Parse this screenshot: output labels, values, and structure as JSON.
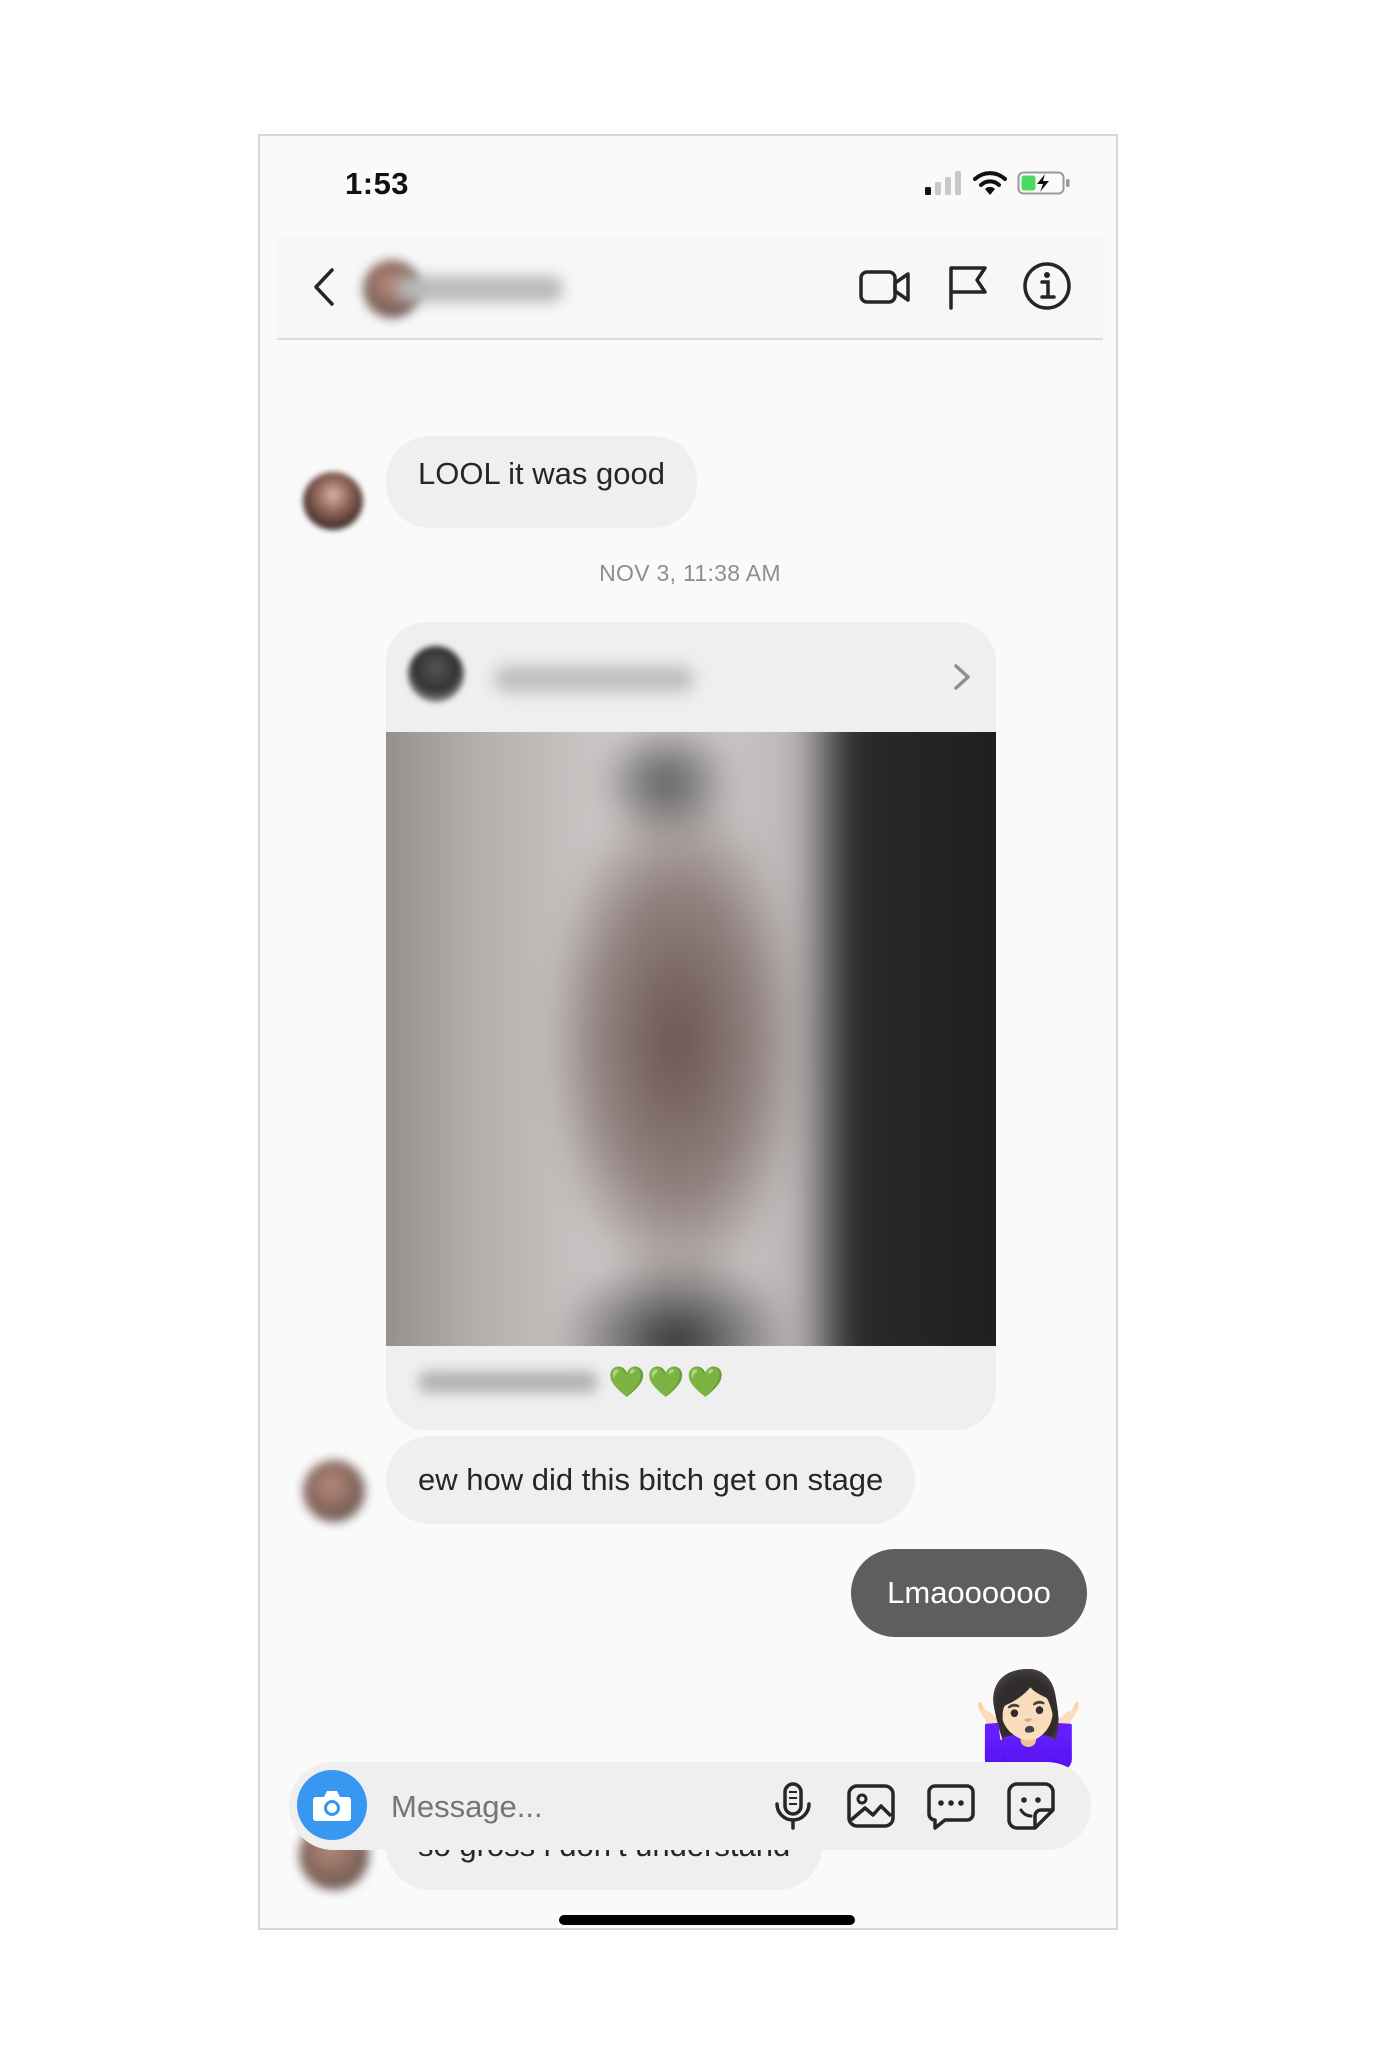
{
  "status_bar": {
    "time": "1:53"
  },
  "header": {
    "back_icon": "chevron-left-icon",
    "video_icon": "video-camera-icon",
    "flag_icon": "flag-icon",
    "info_icon": "info-icon"
  },
  "messages": {
    "prev_in": "LOOL it was good",
    "timestamp": "NOV 3, 11:38 AM",
    "share_caption_emoji": "💚💚💚",
    "in_1": "ew how did this bitch get on stage",
    "out_1": "Lmaoooooo",
    "out_emoji": "🤷🏻‍♀️",
    "in_2": "so gross i don’t understand"
  },
  "composer": {
    "placeholder": "Message...",
    "icons": [
      "camera-icon",
      "microphone-icon",
      "gallery-icon",
      "chat-bubble-icon",
      "sticker-icon"
    ]
  },
  "colors": {
    "accent": "#3897f0",
    "outgoing_bubble": "#5e5e5e",
    "incoming_bubble": "#efefef",
    "battery_green": "#4cd964"
  }
}
